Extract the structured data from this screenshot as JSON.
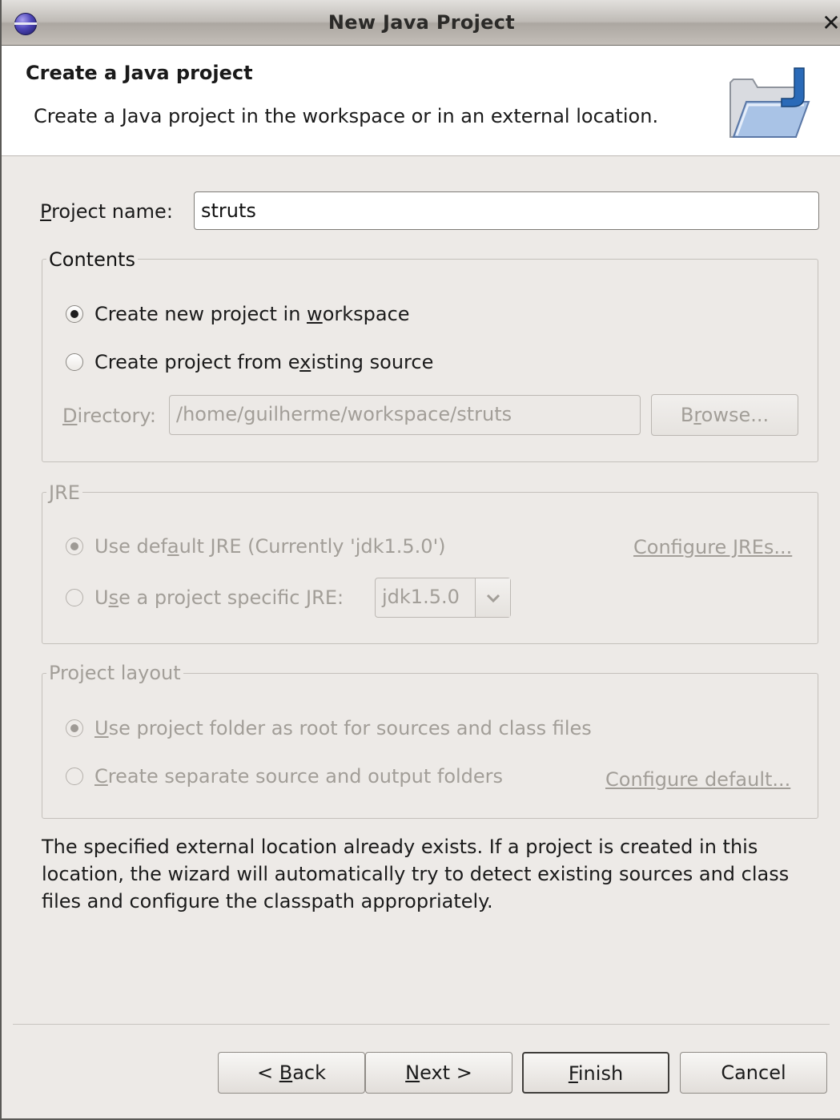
{
  "window": {
    "title": "New Java Project"
  },
  "banner": {
    "title": "Create a Java project",
    "description": "Create a Java project in the workspace or in an external location."
  },
  "project_name": {
    "label_mn": "P",
    "label_rest": "roject name:",
    "value": "struts"
  },
  "contents": {
    "title": "Contents",
    "option_new": {
      "pre": "Create new project in ",
      "mn": "w",
      "post": "orkspace",
      "selected": true
    },
    "option_existing": {
      "pre": "Create project from e",
      "mn": "x",
      "post": "isting source",
      "selected": false
    },
    "directory_label": {
      "mn": "D",
      "rest": "irectory:"
    },
    "directory_value": "/home/guilherme/workspace/struts",
    "browse": {
      "pre": "B",
      "mn": "r",
      "post": "owse..."
    }
  },
  "jre": {
    "title": "JRE",
    "option_default": {
      "pre": "Use def",
      "mn": "a",
      "post": "ult JRE (Currently 'jdk1.5.0')",
      "selected": true
    },
    "option_specific": {
      "pre": "U",
      "mn": "s",
      "post": "e a project specific JRE:",
      "selected": false
    },
    "combo_value": "jdk1.5.0",
    "configure_link": "Configure JREs..."
  },
  "layout": {
    "title": "Project layout",
    "option_root": {
      "mn": "U",
      "post": "se project folder as root for sources and class files",
      "selected": true
    },
    "option_separate": {
      "mn": "C",
      "post": "reate separate source and output folders",
      "selected": false
    },
    "configure_link": "Configure default..."
  },
  "info_text": "The specified external location already exists. If a project is created in this location, the wizard will automatically try to detect existing sources and class files and configure the classpath appropriately.",
  "buttons": {
    "back": {
      "pre": "< ",
      "mn": "B",
      "post": "ack"
    },
    "next": {
      "pre": "",
      "mn": "N",
      "post": "ext >"
    },
    "finish": {
      "pre": "",
      "mn": "F",
      "post": "inish"
    },
    "cancel": "Cancel"
  }
}
